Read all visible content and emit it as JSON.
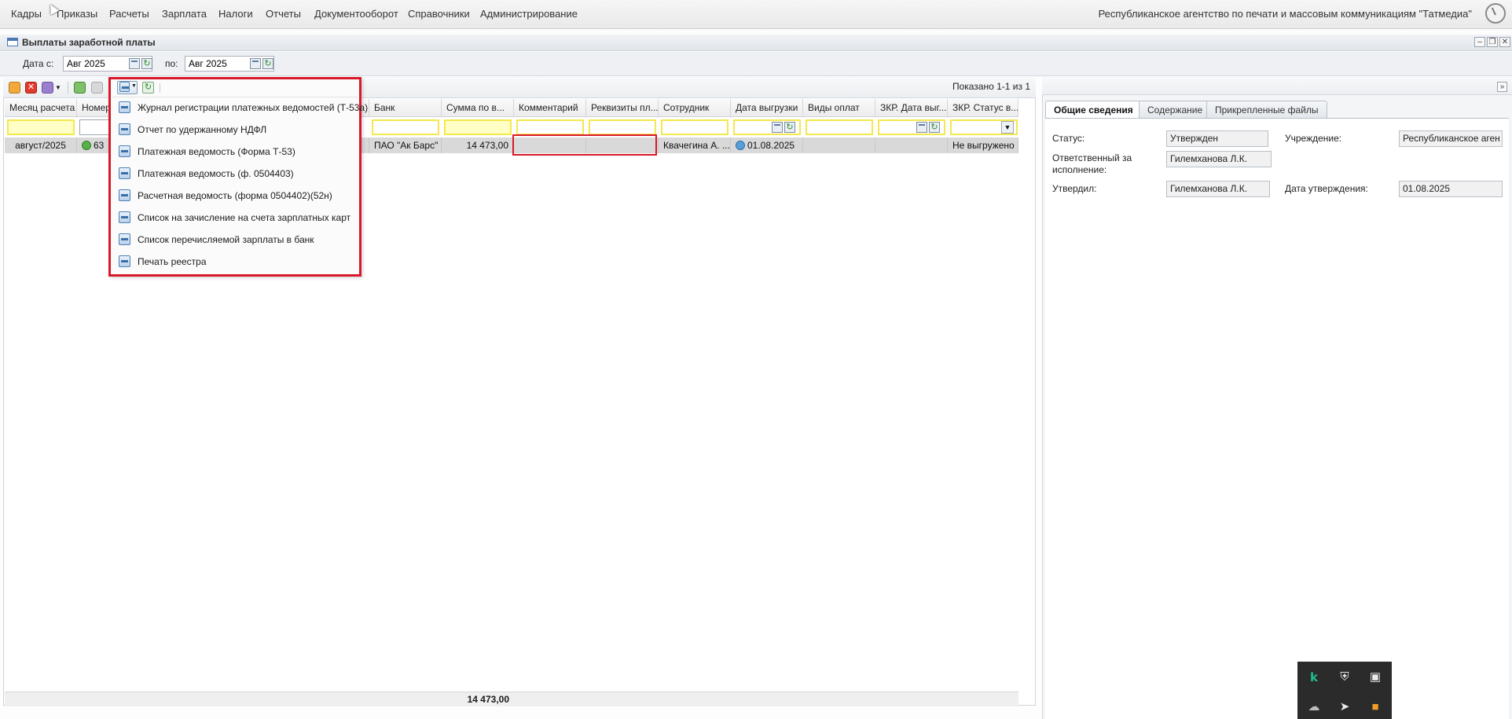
{
  "menu": {
    "items": [
      "Кадры",
      "Приказы",
      "Расчеты",
      "Зарплата",
      "Налоги",
      "Отчеты",
      "Документооборот",
      "Справочники",
      "Администрирование"
    ],
    "org_name": "Республиканское агентство по печати и массовым коммуникациям \"Татмедиа\""
  },
  "window": {
    "title": "Выплаты заработной платы"
  },
  "filter": {
    "date_from_label": "Дата с:",
    "date_from_value": "Авг 2025",
    "date_to_label": "по:",
    "date_to_value": "Авг 2025"
  },
  "grid": {
    "shown_count": "Показано 1-1 из 1",
    "columns": [
      "Месяц расчета",
      "Номер",
      "Банк",
      "Сумма по в...",
      "Комментарий",
      "Реквизиты пл...",
      "Сотрудник",
      "Дата выгрузки",
      "Виды оплат",
      "ЗКР. Дата выг...",
      "ЗКР. Статус в..."
    ],
    "row": {
      "month": "август/2025",
      "number": "63",
      "bank": "ПАО \"Ак Барс\"",
      "sum": "14 473,00",
      "comment": "",
      "requisites": "",
      "employee": "Квачегина А. ...",
      "export_date": "01.08.2025",
      "payment_types": "",
      "zkr_date": "",
      "zkr_status": "Не выгружено"
    },
    "total_sum": "14 473,00"
  },
  "print_menu": {
    "items": [
      "Журнал регистрации платежных ведомостей (Т-53а)",
      "Отчет по удержанному НДФЛ",
      "Платежная ведомость (Форма Т-53)",
      "Платежная ведомость (ф. 0504403)",
      "Расчетная ведомость (форма 0504402)(52н)",
      "Список на зачисление на счета зарплатных карт",
      "Список перечисляемой зарплаты в банк",
      "Печать реестра"
    ]
  },
  "details": {
    "tabs": [
      "Общие сведения",
      "Содержание",
      "Прикрепленные файлы"
    ],
    "status_label": "Статус:",
    "status_value": "Утвержден",
    "institution_label": "Учреждение:",
    "institution_value": "Республиканское аген",
    "responsible_label_1": "Ответственный за",
    "responsible_label_2": "исполнение:",
    "responsible_value": "Гилемханова Л.К.",
    "approved_by_label": "Утвердил:",
    "approved_by_value": "Гилемханова Л.К.",
    "approval_date_label": "Дата утверждения:",
    "approval_date_value": "01.08.2025"
  },
  "tray": {
    "icons": [
      "kaspersky-icon",
      "shield-warning-icon",
      "network-icon",
      "cloud-off-icon",
      "telegram-icon",
      "package-icon"
    ]
  },
  "colors": {
    "highlight_red": "#d9182b",
    "filter_yellow": "#ffffc6",
    "selected_row": "#d9d9d9",
    "ok_green": "#58b04c"
  }
}
